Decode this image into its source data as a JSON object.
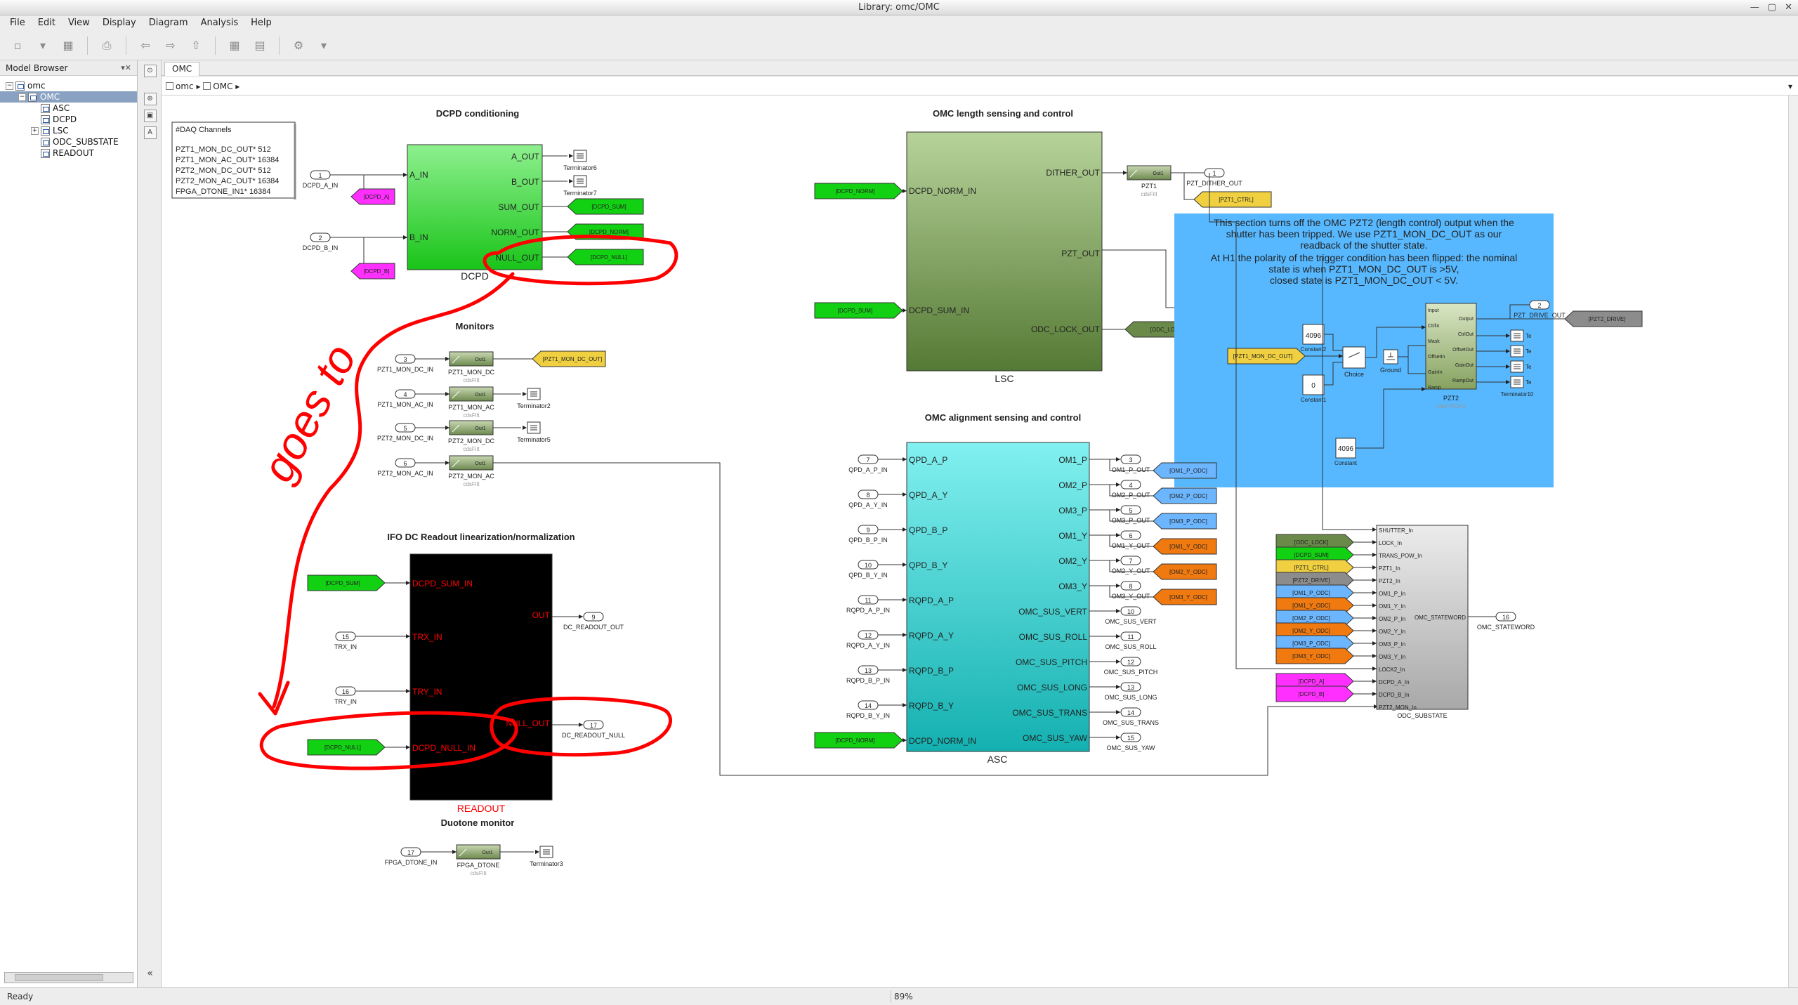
{
  "window": {
    "title": "Library: omc/OMC"
  },
  "menu": [
    "File",
    "Edit",
    "View",
    "Display",
    "Diagram",
    "Analysis",
    "Help"
  ],
  "browser": {
    "title": "Model Browser",
    "tree": [
      {
        "label": "omc",
        "level": 0,
        "expander": "−",
        "selected": false
      },
      {
        "label": "OMC",
        "level": 1,
        "expander": "−",
        "selected": true
      },
      {
        "label": "ASC",
        "level": 2,
        "expander": "",
        "selected": false
      },
      {
        "label": "DCPD",
        "level": 2,
        "expander": "",
        "selected": false
      },
      {
        "label": "LSC",
        "level": 2,
        "expander": "+",
        "selected": false
      },
      {
        "label": "ODC_SUBSTATE",
        "level": 2,
        "expander": "",
        "selected": false
      },
      {
        "label": "READOUT",
        "level": 2,
        "expander": "",
        "selected": false
      }
    ]
  },
  "tab": {
    "label": "OMC"
  },
  "breadcrumb": {
    "root": "omc",
    "child": "OMC"
  },
  "status": {
    "text": "Ready",
    "zoom": "89%"
  },
  "colors": {
    "green": "#12d012",
    "magenta": "#ff30ff",
    "yellow": "#f0d040",
    "orange": "#f07a10",
    "lightblue": "#6cb6ff",
    "gray": "#8c8c8c",
    "olive": "#6a8a4a",
    "darkred": "#ff0000",
    "annotation": "#57b8ff"
  },
  "diagram": {
    "groups": [
      {
        "title": "DCPD conditioning"
      },
      {
        "title": "OMC length sensing and control"
      },
      {
        "title": "Monitors"
      },
      {
        "title": "OMC alignment sensing and control"
      },
      {
        "title": "IFO DC Readout linearization/normalization"
      },
      {
        "title": "Duotone monitor"
      }
    ],
    "daq": {
      "header": "#DAQ Channels",
      "lines": [
        "PZT1_MON_DC_OUT* 512",
        "PZT1_MON_AC_OUT* 16384",
        "PZT2_MON_DC_OUT* 512",
        "PZT2_MON_AC_OUT* 16384",
        "FPGA_DTONE_IN1* 16384"
      ]
    },
    "annotation": "This section turns off the OMC PZT2 (length control) output when the shutter has been tripped.  We use PZT1_MON_DC_OUT as our readback of the shutter state.\nAt H1 the polarity of the trigger condition has been flipped: the nominal state is when PZT1_MON_DC_OUT is >5V,\nclosed state is PZT1_MON_DC_OUT < 5V.",
    "handwriting": "goes to",
    "dcpd": {
      "name": "DCPD",
      "inputs": [
        "A_IN",
        "B_IN"
      ],
      "outputs": [
        "A_OUT",
        "B_OUT",
        "SUM_OUT",
        "NORM_OUT",
        "NULL_OUT"
      ],
      "inports": [
        {
          "num": "1",
          "label": "DCPD_A_IN"
        },
        {
          "num": "2",
          "label": "DCPD_B_IN"
        }
      ],
      "tags_in": [
        "[DCPD_A]",
        "[DCPD_B]"
      ],
      "tags_out": [
        "[DCPD_SUM]",
        "[DCPD_NORM]",
        "[DCPD_NULL]"
      ],
      "terminators": [
        "Terminator6",
        "Terminator7"
      ]
    },
    "lsc": {
      "name": "LSC",
      "inputs": [
        "DCPD_NORM_IN",
        "DCPD_SUM_IN"
      ],
      "outputs": [
        "DITHER_OUT",
        "PZT_OUT",
        "ODC_LOCK_OUT"
      ],
      "tags_in": [
        "[DCPD_NORM]",
        "[DCPD_SUM]"
      ],
      "pzt1_label": "PZT1",
      "pzt1_sub": "cdsFilt",
      "filt_out": "Out1",
      "outport": {
        "num": "1",
        "label": "PZT_DITHER_OUT"
      },
      "tag_ctrl": "[PZT1_CTRL]",
      "tag_lock": "[ODC_LOCK]"
    },
    "monitors": {
      "rows": [
        {
          "num": "3",
          "in": "PZT1_MON_DC_IN",
          "filt": "PZT1_MON_DC",
          "dest": "[PZT1_MON_DC_OUT]"
        },
        {
          "num": "4",
          "in": "PZT1_MON_AC_IN",
          "filt": "PZT1_MON_AC",
          "dest": "Terminator2"
        },
        {
          "num": "5",
          "in": "PZT2_MON_DC_IN",
          "filt": "PZT2_MON_DC",
          "dest": "Terminator5"
        },
        {
          "num": "6",
          "in": "PZT2_MON_AC_IN",
          "filt": "PZT2_MON_AC",
          "dest": ""
        }
      ],
      "sub": "cdsFilt",
      "out": "Out1"
    },
    "pzt2": {
      "const1": "4096",
      "const1_label": "Constant2",
      "const2": "0",
      "const2_label": "Constant1",
      "const3": "4096",
      "const3_label": "Constant",
      "choice": "Choice",
      "ground": "Ground",
      "tag_in": "[PZT1_MON_DC_OUT]",
      "name": "PZT2",
      "sub": "cdsFWCtrl2",
      "ports_in": [
        "Input",
        "Ctrlin",
        "Mask",
        "OffsetIn",
        "GainIn",
        "Ramp"
      ],
      "ports_out": [
        "Output",
        "CtrlOut",
        "OffsetOut",
        "GainOut",
        "RampOut"
      ],
      "outport": {
        "num": "2",
        "label": "PZT_DRIVE_OUT"
      },
      "tag_drive": "[PZT2_DRIVE]",
      "terms": [
        "Te",
        "Te",
        "Te",
        "Te",
        "Terminator10"
      ]
    },
    "asc": {
      "name": "ASC",
      "inputs": [
        "QPD_A_P",
        "QPD_A_Y",
        "QPD_B_P",
        "QPD_B_Y",
        "RQPD_A_P",
        "RQPD_A_Y",
        "RQPD_B_P",
        "RQPD_B_Y",
        "DCPD_NORM_IN"
      ],
      "in_ports": [
        {
          "num": "7",
          "label": "QPD_A_P_IN"
        },
        {
          "num": "8",
          "label": "QPD_A_Y_IN"
        },
        {
          "num": "9",
          "label": "QPD_B_P_IN"
        },
        {
          "num": "10",
          "label": "QPD_B_Y_IN"
        },
        {
          "num": "11",
          "label": "RQPD_A_P_IN"
        },
        {
          "num": "12",
          "label": "RQPD_A_Y_IN"
        },
        {
          "num": "13",
          "label": "RQPD_B_P_IN"
        },
        {
          "num": "14",
          "label": "RQPD_B_Y_IN"
        }
      ],
      "tag_norm": "[DCPD_NORM]",
      "outputs": [
        "OM1_P",
        "OM2_P",
        "OM3_P",
        "OM1_Y",
        "OM2_Y",
        "OM3_Y",
        "OMC_SUS_VERT",
        "OMC_SUS_ROLL",
        "OMC_SUS_PITCH",
        "OMC_SUS_LONG",
        "OMC_SUS_TRANS",
        "OMC_SUS_YAW"
      ],
      "out_ports": [
        {
          "num": "3",
          "label": "OM1_P_OUT"
        },
        {
          "num": "4",
          "label": "OM2_P_OUT"
        },
        {
          "num": "5",
          "label": "OM3_P_OUT"
        },
        {
          "num": "6",
          "label": "OM1_Y_OUT"
        },
        {
          "num": "7",
          "label": "OM2_Y_OUT"
        },
        {
          "num": "8",
          "label": "OM3_Y_OUT"
        },
        {
          "num": "10",
          "label": "OMC_SUS_VERT"
        },
        {
          "num": "11",
          "label": "OMC_SUS_ROLL"
        },
        {
          "num": "12",
          "label": "OMC_SUS_PITCH"
        },
        {
          "num": "13",
          "label": "OMC_SUS_LONG"
        },
        {
          "num": "14",
          "label": "OMC_SUS_TRANS"
        },
        {
          "num": "15",
          "label": "OMC_SUS_YAW"
        }
      ],
      "tags_out": [
        "[OM1_P_ODC]",
        "[OM2_P_ODC]",
        "[OM3_P_ODC]",
        "[OM1_Y_ODC]",
        "[OM2_Y_ODC]",
        "[OM3_Y_ODC]"
      ]
    },
    "odc": {
      "name": "ODC_SUBSTATE",
      "inputs": [
        "SHUTTER_In",
        "LOCK_In",
        "TRANS_POW_In",
        "PZT1_In",
        "PZT2_In",
        "OM1_P_In",
        "OM1_Y_In",
        "OM2_P_In",
        "OM2_Y_In",
        "OM3_P_In",
        "OM3_Y_In",
        "LOCK2_In",
        "DCPD_A_In",
        "DCPD_B_In",
        "PZT2_MON_In"
      ],
      "output": "OMC_STATEWORD",
      "tags": [
        "[ODC_LOCK]",
        "[DCPD_SUM]",
        "[PZT1_CTRL]",
        "[PZT2_DRIVE]",
        "[OM1_P_ODC]",
        "[OM1_Y_ODC]",
        "[OM2_P_ODC]",
        "[OM2_Y_ODC]",
        "[OM3_P_ODC]",
        "[OM3_Y_ODC]",
        "[DCPD_A]",
        "[DCPD_B]"
      ],
      "outport": {
        "num": "16",
        "label": "OMC_STATEWORD"
      }
    },
    "readout": {
      "name": "READOUT",
      "inputs": [
        "DCPD_SUM_IN",
        "TRX_IN",
        "TRY_IN",
        "DCPD_NULL_IN"
      ],
      "outputs": [
        "OUT",
        "NULL_OUT"
      ],
      "tag_sum": "[DCPD_SUM]",
      "tag_null": "[DCPD_NULL]",
      "in_ports": [
        {
          "num": "15",
          "label": "TRX_IN"
        },
        {
          "num": "16",
          "label": "TRY_IN"
        }
      ],
      "out_ports": [
        {
          "num": "9",
          "label": "DC_READOUT_OUT"
        },
        {
          "num": "17",
          "label": "DC_READOUT_NULL"
        }
      ]
    },
    "duotone": {
      "num": "17",
      "in": "FPGA_DTONE_IN",
      "filt": "FPGA_DTONE",
      "sub": "cdsFilt",
      "out": "Out1",
      "term": "Terminator3"
    }
  }
}
